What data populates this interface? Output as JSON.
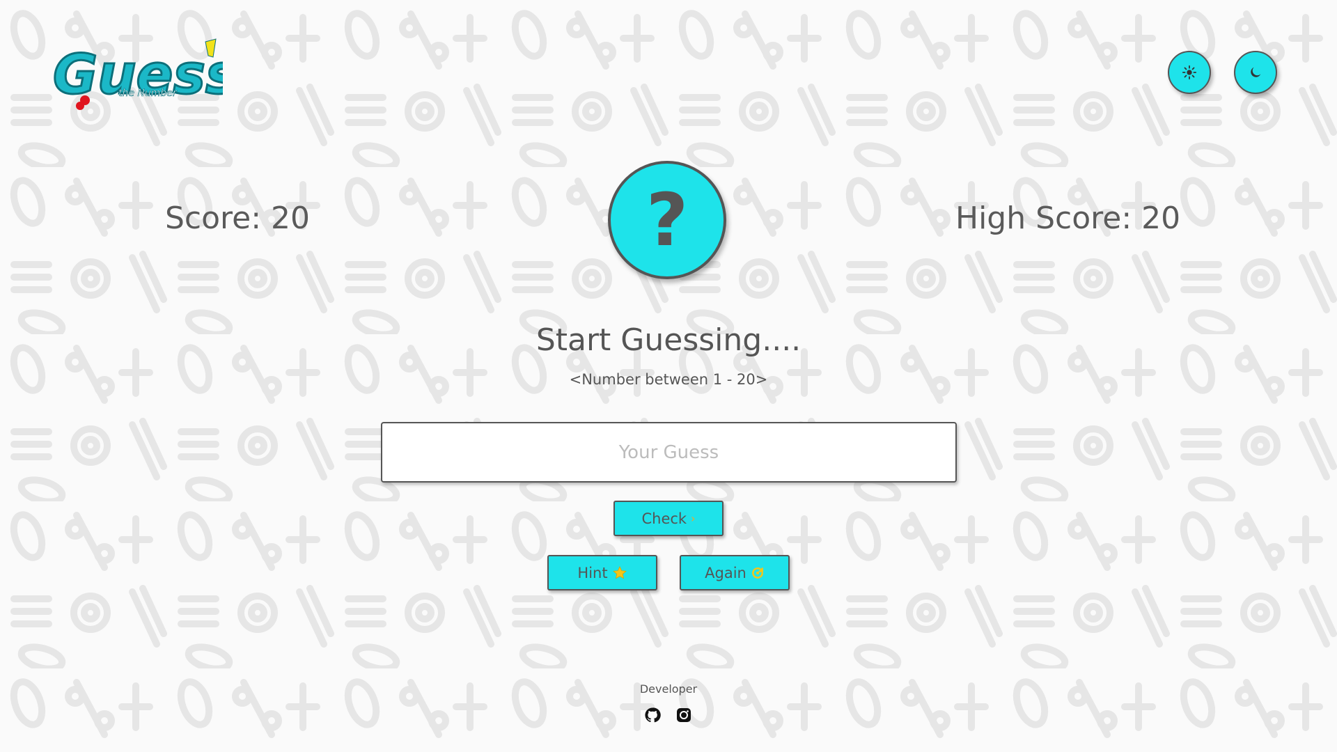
{
  "app": {
    "logo_text": "Guess",
    "logo_subtext": "the Number"
  },
  "theme": {
    "light_icon": "sun-icon",
    "dark_icon": "moon-icon"
  },
  "score": {
    "text": "Score: 20",
    "value": 20
  },
  "high_score": {
    "text": "High Score: 20",
    "value": 20
  },
  "mystery": {
    "symbol": "?"
  },
  "message": "Start Guessing....",
  "range_label": "<Number between 1 - 20>",
  "input": {
    "placeholder": "Your Guess",
    "value": ""
  },
  "buttons": {
    "check_label": "Check",
    "check_icon": "chevron-right-icon",
    "hint_label": "Hint",
    "hint_icon": "star-icon",
    "again_label": "Again",
    "again_icon": "refresh-icon"
  },
  "footer": {
    "label": "Developer",
    "links": [
      "github-icon",
      "instagram-icon"
    ]
  },
  "colors": {
    "accent": "#1ee3ea",
    "text": "#555555",
    "background": "#fafafa",
    "star": "#f5c518"
  }
}
